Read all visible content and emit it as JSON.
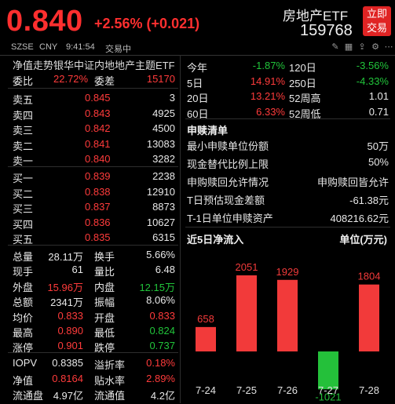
{
  "header": {
    "price": "0.840",
    "change": "+2.56% (+0.021)",
    "name": "房地产ETF",
    "code": "159768",
    "trade_button": [
      "立即",
      "交易"
    ]
  },
  "subbar": {
    "exchange": "SZSE",
    "currency": "CNY",
    "time": "9:41:54",
    "status": "交易中"
  },
  "left": {
    "title": "净值走势银华中证内地地产主题ETF",
    "weibi": {
      "label": "委比",
      "value": "22.72%",
      "label2": "委差",
      "value2": "15170"
    },
    "asks": [
      {
        "label": "卖五",
        "price": "0.845",
        "vol": "3"
      },
      {
        "label": "卖四",
        "price": "0.843",
        "vol": "4925"
      },
      {
        "label": "卖三",
        "price": "0.842",
        "vol": "4500"
      },
      {
        "label": "卖二",
        "price": "0.841",
        "vol": "13083"
      },
      {
        "label": "卖一",
        "price": "0.840",
        "vol": "3282"
      }
    ],
    "bids": [
      {
        "label": "买一",
        "price": "0.839",
        "vol": "2238"
      },
      {
        "label": "买二",
        "price": "0.838",
        "vol": "12910"
      },
      {
        "label": "买三",
        "price": "0.837",
        "vol": "8873"
      },
      {
        "label": "买四",
        "price": "0.836",
        "vol": "10627"
      },
      {
        "label": "买五",
        "price": "0.835",
        "vol": "6315"
      }
    ],
    "stats": [
      {
        "l1": "总量",
        "v1": "28.11万",
        "c1": "white",
        "l2": "换手",
        "v2": "5.66%",
        "c2": "white"
      },
      {
        "l1": "现手",
        "v1": "61",
        "c1": "white",
        "l2": "量比",
        "v2": "6.48",
        "c2": "white"
      },
      {
        "l1": "外盘",
        "v1": "15.96万",
        "c1": "red",
        "l2": "内盘",
        "v2": "12.15万",
        "c2": "green"
      },
      {
        "l1": "总额",
        "v1": "2341万",
        "c1": "white",
        "l2": "振幅",
        "v2": "8.06%",
        "c2": "white"
      },
      {
        "l1": "均价",
        "v1": "0.833",
        "c1": "red",
        "l2": "开盘",
        "v2": "0.833",
        "c2": "red"
      },
      {
        "l1": "最高",
        "v1": "0.890",
        "c1": "red",
        "l2": "最低",
        "v2": "0.824",
        "c2": "green"
      },
      {
        "l1": "涨停",
        "v1": "0.901",
        "c1": "red",
        "l2": "跌停",
        "v2": "0.737",
        "c2": "green"
      }
    ],
    "iopv": [
      {
        "l1": "IOPV",
        "v1": "0.8385",
        "c1": "white",
        "l2": "溢折率",
        "v2": "0.18%",
        "c2": "red"
      },
      {
        "l1": "净值",
        "v1": "0.8164",
        "c1": "red",
        "l2": "贴水率",
        "v2": "2.89%",
        "c2": "red"
      },
      {
        "l1": "流通盘",
        "v1": "4.97亿",
        "c1": "white",
        "l2": "流通值",
        "v2": "4.2亿",
        "c2": "white"
      }
    ]
  },
  "right": {
    "perf": [
      {
        "l1": "今年",
        "v1": "-1.87%",
        "c1": "green",
        "l2": "120日",
        "v2": "-3.56%",
        "c2": "green"
      },
      {
        "l1": "5日",
        "v1": "14.91%",
        "c1": "red",
        "l2": "250日",
        "v2": "-4.33%",
        "c2": "green"
      },
      {
        "l1": "20日",
        "v1": "13.21%",
        "c1": "red",
        "l2": "52周高",
        "v2": "1.01",
        "c2": "white"
      },
      {
        "l1": "60日",
        "v1": "6.33%",
        "c1": "red",
        "l2": "52周低",
        "v2": "0.71",
        "c2": "white"
      }
    ],
    "subscription": {
      "title": "申赎清单",
      "rows": [
        {
          "label": "最小申赎单位份额",
          "value": "50万"
        },
        {
          "label": "现金替代比例上限",
          "value": "50%"
        },
        {
          "label": "申购赎回允许情况",
          "value": "申购赎回皆允许"
        },
        {
          "label": "T日预估现金差额",
          "value": "-61.38元"
        },
        {
          "label": "T-1日单位申赎资产",
          "value": "408216.62元"
        }
      ]
    },
    "flow": {
      "title": "近5日净流入",
      "unit": "单位(万元)"
    }
  },
  "chart_data": {
    "type": "bar",
    "categories": [
      "7-24",
      "7-25",
      "7-26",
      "7-27",
      "7-28"
    ],
    "values": [
      658,
      2051,
      1929,
      -1021,
      1804
    ],
    "colors": {
      "positive": "#f23a3a",
      "negative": "#24c03a"
    }
  }
}
